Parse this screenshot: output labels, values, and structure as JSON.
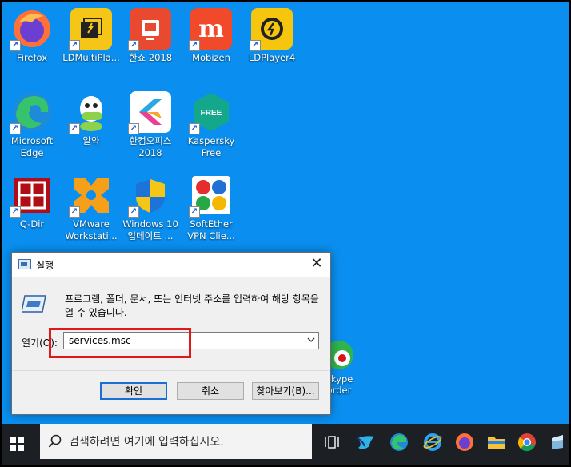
{
  "desktop": {
    "icons": [
      {
        "label": "Firefox"
      },
      {
        "label": "LDMultiPla..."
      },
      {
        "label": "한쇼 2018"
      },
      {
        "label": "Mobizen"
      },
      {
        "label": "LDPlayer4"
      },
      {
        "label": "Microsoft Edge"
      },
      {
        "label": "알약"
      },
      {
        "label": "한컴오피스 2018"
      },
      {
        "label": "Kaspersky Free"
      },
      {
        "label": "Q-Dir"
      },
      {
        "label": "VMware Workstati..."
      },
      {
        "label": "Windows 10 업데이트 ..."
      },
      {
        "label": "SoftEther VPN Clie..."
      },
      {
        "label": "Skype order"
      }
    ],
    "icon_glyphs": {
      "mobizen": "m",
      "kaspersky": "FREE"
    }
  },
  "run_dialog": {
    "title": "실행",
    "close": "✕",
    "description": "프로그램, 폴더, 문서, 또는 인터넷 주소를 입력하여 해당 항목을 열 수 있습니다.",
    "open_label": "열기(O):",
    "input_value": "services.msc",
    "ok_label": "확인",
    "cancel_label": "취소",
    "browse_label": "찾아보기(B)...",
    "highlight_color": "#e0181b"
  },
  "taskbar": {
    "search_placeholder": "검색하려면 여기에 입력하십시오.",
    "pinned": [
      "task-view-icon",
      "bird-app-icon",
      "edge-icon",
      "internet-explorer-icon",
      "firefox-icon",
      "file-explorer-icon",
      "chrome-icon",
      "app-icon"
    ]
  },
  "colors": {
    "desktop": "#0a8ff0",
    "taskbar": "#1c1f24",
    "accent": "#1a6fd4"
  }
}
